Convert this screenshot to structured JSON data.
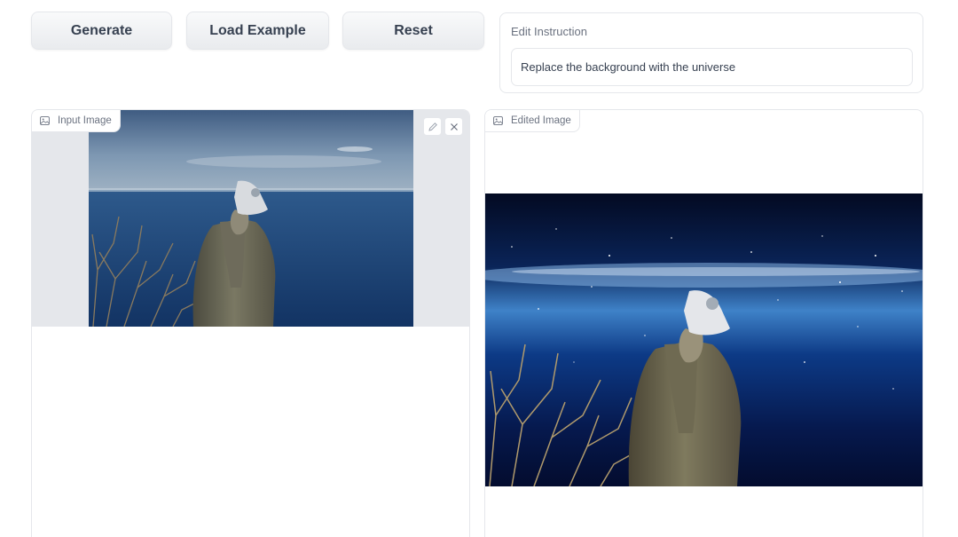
{
  "toolbar": {
    "generate_label": "Generate",
    "load_example_label": "Load Example",
    "reset_label": "Reset"
  },
  "instruction": {
    "label": "Edit Instruction",
    "value": "Replace the background with the universe"
  },
  "input_panel": {
    "label": "Input Image",
    "icons": [
      "image-icon",
      "pencil-icon",
      "close-icon"
    ]
  },
  "output_panel": {
    "label": "Edited Image",
    "icons": [
      "image-icon"
    ]
  },
  "colors": {
    "border": "#e5e7eb",
    "button_text": "#374151",
    "label_text": "#6b7280",
    "input_frame_bg": "#e5e7eb"
  }
}
